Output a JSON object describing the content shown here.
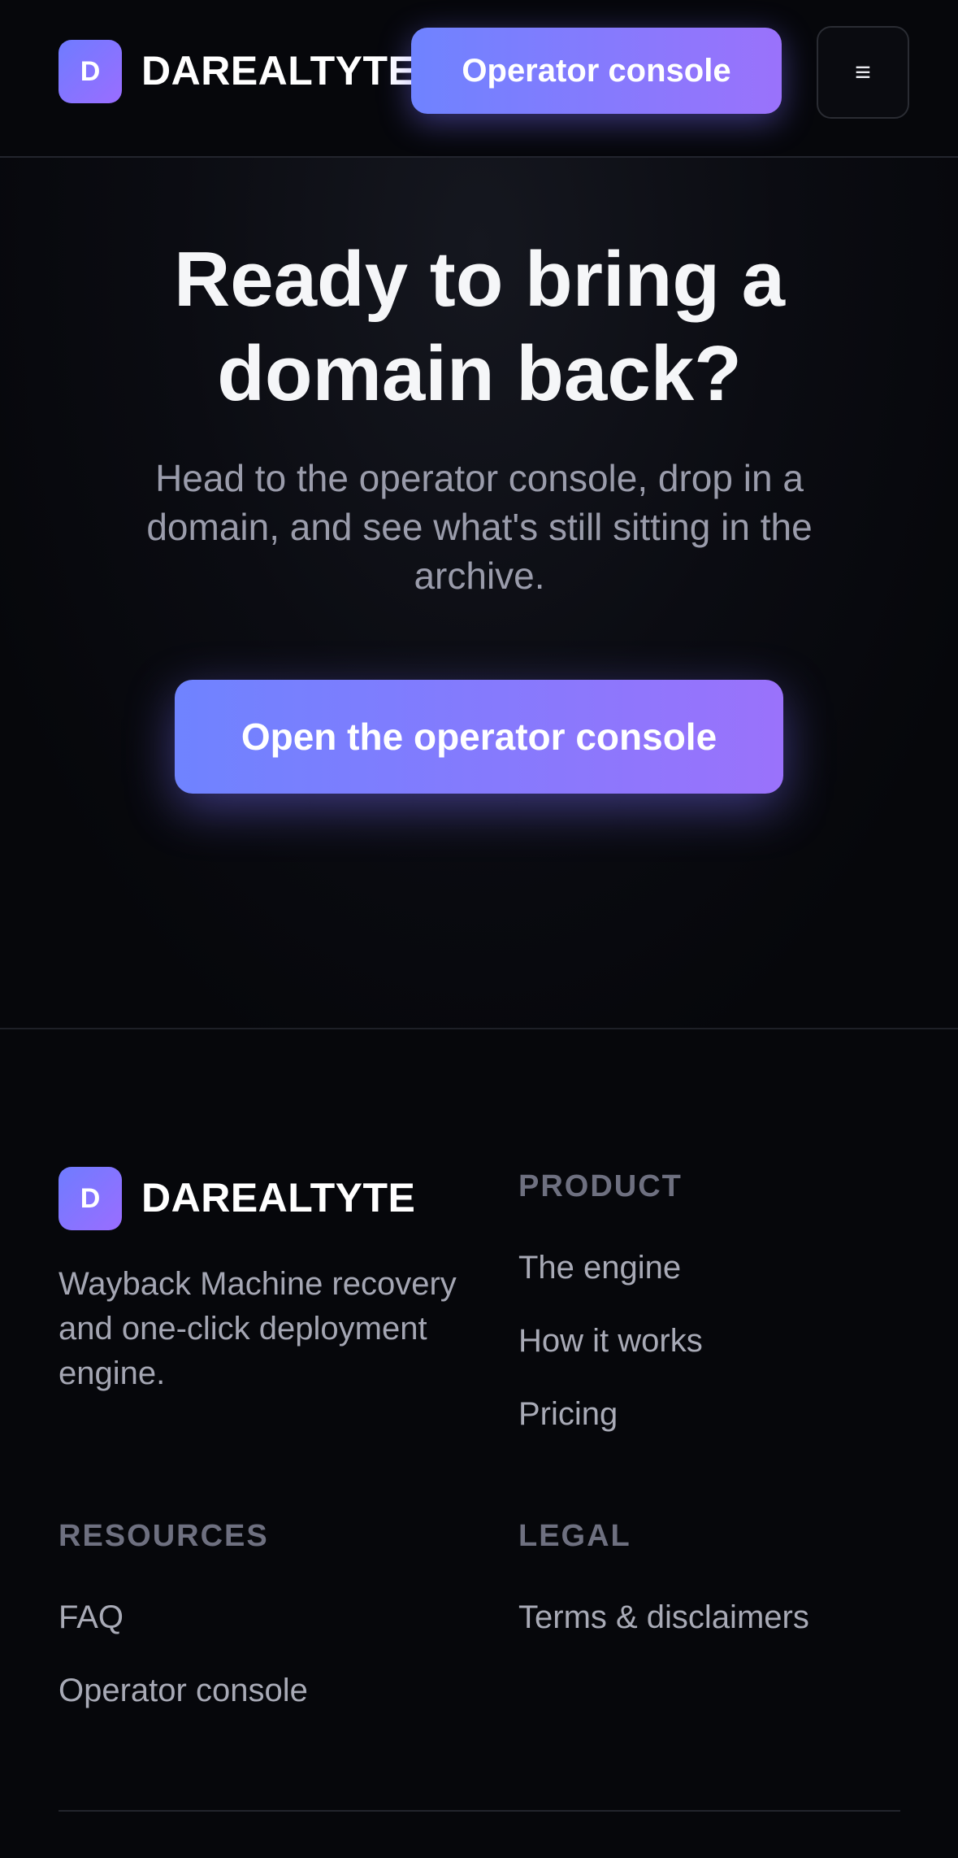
{
  "brand": {
    "mark": "D",
    "name": "DAREALTYTE"
  },
  "header": {
    "cta_label": "Operator console",
    "menu_glyph": "≡"
  },
  "hero": {
    "title_line1": "Ready to bring a",
    "title_line2": "domain back?",
    "description": "Head to the operator console, drop in a domain, and see what's still sitting in the archive.",
    "cta_label": "Open the operator console"
  },
  "footer": {
    "tagline": "Wayback Machine recovery and one-click deployment engine.",
    "columns": {
      "product": {
        "heading": "PRODUCT",
        "links": [
          "The engine",
          "How it works",
          "Pricing"
        ]
      },
      "resources": {
        "heading": "RESOURCES",
        "links": [
          "FAQ",
          "Operator console"
        ]
      },
      "legal": {
        "heading": "LEGAL",
        "links": [
          "Terms & disclaimers"
        ]
      }
    }
  },
  "colors": {
    "accent_start": "#6f83ff",
    "accent_end": "#9a72fb",
    "background": "#06070b"
  },
  "icons": {
    "menu": "hamburger-menu-icon"
  }
}
